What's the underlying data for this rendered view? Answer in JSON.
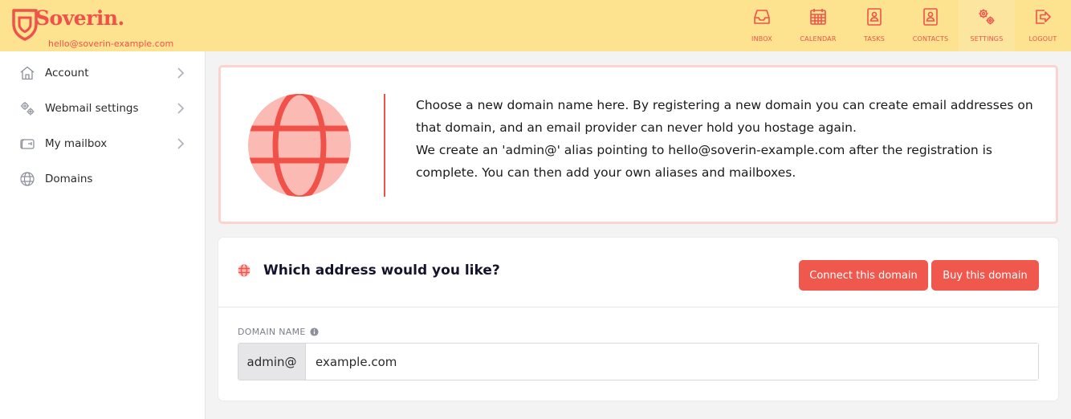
{
  "header": {
    "brand": "Soverin.",
    "email": "hello@soverin-example.com",
    "nav": [
      {
        "label": "INBOX",
        "icon": "inbox-icon"
      },
      {
        "label": "CALENDAR",
        "icon": "calendar-icon"
      },
      {
        "label": "TASKS",
        "icon": "tasks-icon"
      },
      {
        "label": "CONTACTS",
        "icon": "contacts-icon"
      },
      {
        "label": "SETTINGS",
        "icon": "settings-icon"
      },
      {
        "label": "LOGOUT",
        "icon": "logout-icon"
      }
    ],
    "active_nav": "SETTINGS"
  },
  "sidebar": {
    "items": [
      {
        "label": "Account",
        "icon": "home-icon",
        "has_chevron": true
      },
      {
        "label": "Webmail settings",
        "icon": "gears-icon",
        "has_chevron": true
      },
      {
        "label": "My mailbox",
        "icon": "mailbox-icon",
        "has_chevron": true
      },
      {
        "label": "Domains",
        "icon": "globe-icon",
        "has_chevron": false
      }
    ]
  },
  "banner": {
    "line1": "Choose a new domain name here. By registering a new domain you can create email addresses on that domain, and an email provider can never hold you hostage again.",
    "line2": "We create an 'admin@' alias pointing to hello@soverin-example.com after the registration is complete. You can then add your own aliases and mailboxes."
  },
  "card": {
    "title": "Which address would you like?",
    "connect_label": "Connect this domain",
    "buy_label": "Buy this domain",
    "field_label": "DOMAIN NAME",
    "prefix": "admin@",
    "domain_value": "example.com"
  },
  "colors": {
    "accent": "#f0524a",
    "header_bg": "#fde290",
    "button": "#f0584e",
    "banner_border": "#fbd4d0",
    "globe_fill": "#fbbab4"
  }
}
